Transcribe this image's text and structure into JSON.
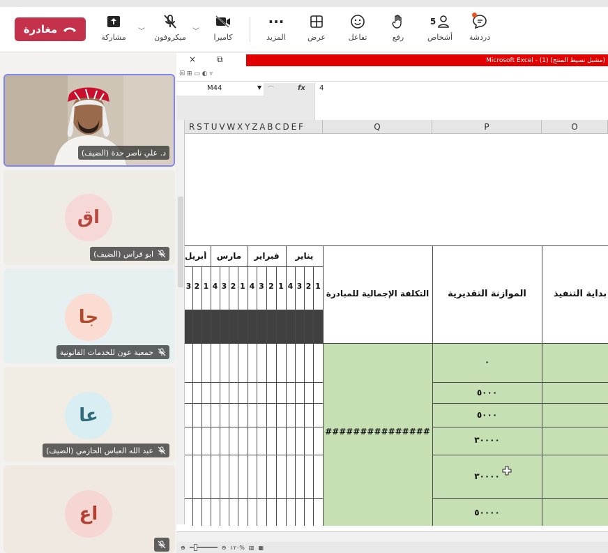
{
  "toolbar": {
    "leave_label": "مغادرة",
    "share_label": "مشاركة",
    "mic_label": "ميكروفون",
    "camera_label": "كاميرا",
    "more_label": "المزيد",
    "view_label": "عرض",
    "react_label": "تفاعل",
    "raise_label": "رفع",
    "people_label": "أشخاص",
    "people_count": "5",
    "chat_label": "دردشة",
    "more_glyph": "···"
  },
  "participants": [
    {
      "name": "د. علي ناصر حدة (الضيف)",
      "type": "video",
      "muted": false
    },
    {
      "name": "ابو فراس (الضيف)",
      "initials": "اق",
      "avatar_bg": "#f6d9d6",
      "avatar_fg": "#b8473e",
      "tile_bg": "#efece6",
      "muted": true
    },
    {
      "name": "جمعية عون للخدمات القانونية",
      "initials": "جا",
      "avatar_bg": "#fbdcd2",
      "avatar_fg": "#b14a2b",
      "tile_bg": "#e6f0f0",
      "muted": true
    },
    {
      "name": "عبد الله العباس الحازمي (الضيف)",
      "initials": "عا",
      "avatar_bg": "#d9eef2",
      "avatar_fg": "#2f6b79",
      "tile_bg": "#f1ece4",
      "muted": true
    },
    {
      "name": "",
      "initials": "اع",
      "avatar_bg": "#f6d6d2",
      "avatar_fg": "#b23f2f",
      "tile_bg": "#efe9e1",
      "muted": true
    }
  ],
  "excel": {
    "title": "Microsoft Excel - (1) (مشبل نسيط المنتج)",
    "close_glyph": "×",
    "restore_glyph": "⧉",
    "ribbon_text": "☒ ⊞ ▭ ◐ ▿",
    "name_box": "M44",
    "fx_label": "fx",
    "formula_value": "4",
    "column_headers": {
      "months_cols": "R S T U V W X Y Z A B C D E F",
      "Q": "Q",
      "P": "P",
      "O": "O"
    },
    "headers": {
      "total_cost": "التكلفة الإجمالية للمبادرة",
      "budget": "الموازنة التقديرية",
      "start": "بداية التنفيذ"
    },
    "months": [
      "يناير",
      "فبراير",
      "مارس",
      "أبريل"
    ],
    "week_numbers": [
      "1",
      "2",
      "3",
      "4"
    ],
    "hash_value": "###############",
    "budget_values": [
      "٠",
      "٥٠٠٠",
      "٥٠٠٠",
      "٣٠٠٠٠",
      "٣٠٠٠٠",
      "٥٠٠٠٠"
    ],
    "zoom_text": "١٢٠%",
    "colors": {
      "green_fill": "#c6e0b4",
      "dark_band": "#404040",
      "title_red": "#e00000"
    }
  }
}
